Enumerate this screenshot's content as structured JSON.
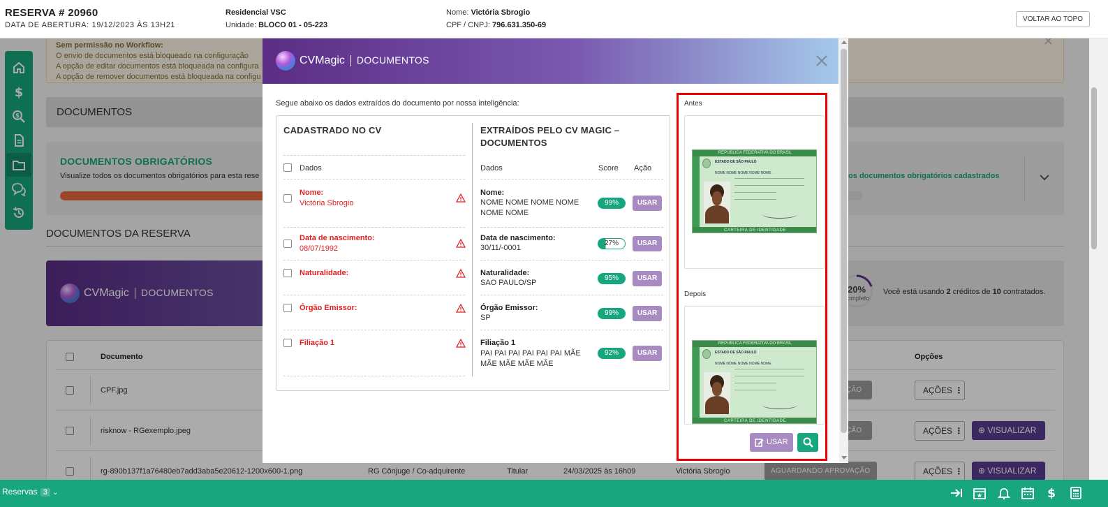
{
  "header": {
    "reserva": "RESERVA # 20960",
    "data_abertura": "DATA DE ABERTURA: 19/12/2023 ÀS 13H21",
    "empreendimento": "Residencial VSC",
    "unidade_label": "Unidade:",
    "unidade_value": "BLOCO 01 - 05-223",
    "nome_label": "Nome:",
    "nome_value": "Victória Sbrogio",
    "cpf_label": "CPF / CNPJ:",
    "cpf_value": "796.631.350-69",
    "voltar_label": "VOLTAR AO TOPO"
  },
  "alert": {
    "title": "Sem permissão no Workflow:",
    "line1": "O envio de documentos está bloqueado na configuração",
    "line2": "A opção de editar documentos está bloqueada na configura",
    "line3": "A opção de remover documentos está bloqueada na configu"
  },
  "documentos_bar": "DOCUMENTOS",
  "obrigatorios": {
    "title": "DOCUMENTOS OBRIGATÓRIOS",
    "text": "Visualize todos os documentos obrigatórios para esta rese",
    "right_text": "los documentos obrigatórios cadastrados",
    "progress": 0.66
  },
  "doc_reserva_title": "DOCUMENTOS DA RESERVA",
  "banner": {
    "brand": "CVMagic",
    "section": "DOCUMENTOS",
    "gauge_pct": "20%",
    "gauge_value": 0.2,
    "gauge_label": "completo",
    "credit_prefix": "Você está usando",
    "credit_used": "2",
    "credit_mid": "créditos de",
    "credit_total": "10",
    "credit_suffix": "contratados."
  },
  "table": {
    "col_documento": "Documento",
    "col_opcoes": "Opções",
    "rows": [
      {
        "documento": "CPF.jpg",
        "status": "ÇÃO",
        "acoes": "AÇÕES"
      },
      {
        "documento": "risknow - RGexemplo.jpeg",
        "status": "ÇÃO",
        "acoes": "AÇÕES",
        "visualizar": "VISUALIZAR"
      },
      {
        "documento": "rg-890b137f1a76480eb7add3aba5e20612-1200x600-1.png",
        "tipo": "RG Cônjuge / Co-adquirente",
        "titular": "Titular",
        "data": "24/03/2025 às 16h09",
        "usuario": "Victória Sbrogio",
        "status": "AGUARDANDO APROVAÇÃO",
        "acoes": "AÇÕES",
        "visualizar": "VISUALIZAR"
      }
    ]
  },
  "modal": {
    "brand": "CVMagic",
    "section": "DOCUMENTOS",
    "intro": "Segue abaixo os dados extraídos do documento por nossa inteligência:",
    "left_title": "CADASTRADO NO CV",
    "right_title_1": "EXTRAÍDOS PELO CV MAGIC –",
    "right_title_2": "DOCUMENTOS",
    "dados_label": "Dados",
    "score_label": "Score",
    "acao_label": "Ação",
    "usar_label": "USAR",
    "rows": [
      {
        "label": "Nome:",
        "cv_value": "Victória Sbrogio",
        "ex_line1": "NOME NOME NOME NOME",
        "ex_line2": "NOME NOME",
        "score": "99%",
        "score_value": 0.99
      },
      {
        "label": "Data de nascimento:",
        "cv_value": "08/07/1992",
        "ex_line1": "30/11/-0001",
        "ex_line2": "",
        "score": "27%",
        "score_value": 0.27
      },
      {
        "label": "Naturalidade:",
        "cv_value": "",
        "ex_line1": "SAO PAULO/SP",
        "ex_line2": "",
        "score": "95%",
        "score_value": 0.95
      },
      {
        "label": "Órgão Emissor:",
        "cv_value": "",
        "ex_line1": "SP",
        "ex_line2": "",
        "score": "99%",
        "score_value": 0.99
      },
      {
        "label": "Filiação 1",
        "cv_value": "",
        "ex_line1": "PAI PAI PAI PAI PAI PAI MÃE",
        "ex_line2": "MÃE MÃE MÃE MÃE",
        "score": "92%",
        "score_value": 0.92
      }
    ],
    "antes_label": "Antes",
    "depois_label": "Depois",
    "usar_button": "USAR",
    "card": {
      "rep": "REPÚBLICA FEDERATIVA DO BRASIL",
      "estado": "ESTADO DE SÃO PAULO",
      "nome": "NOME NOME NOME NOME NOME",
      "footer": "CARTEIRA DE IDENTIDADE"
    }
  },
  "footer": {
    "reservas_label": "Reservas",
    "reservas_count": "3"
  },
  "colors": {
    "green": "#17a67d",
    "purple": "#5a2d86",
    "red_highlight": "#ee0000",
    "error_red": "#e02020"
  }
}
